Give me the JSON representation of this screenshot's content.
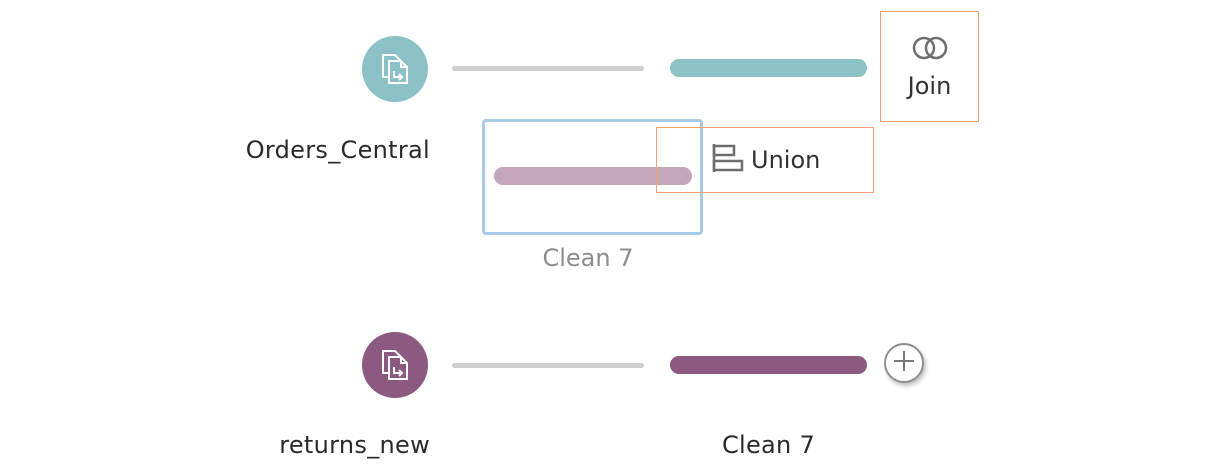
{
  "colors": {
    "teal": "#8dc1c8",
    "mauve": "#8c5a80",
    "mauve_light": "#c3a7b9",
    "connector_gray": "#cfcfcf",
    "drop_target_orange": "#f0a070",
    "ghost_border_blue": "#a6cbe8"
  },
  "flow": {
    "input_1": {
      "label": "Orders_Central",
      "icon": "file-input-icon"
    },
    "input_2": {
      "label": "returns_new",
      "icon": "file-input-icon"
    },
    "clean_2": {
      "label": "Clean 7"
    },
    "dragged_step": {
      "label": "Clean 7"
    },
    "drop_targets": {
      "join_label": "Join",
      "join_icon": "join-circles-icon",
      "union_label": "Union",
      "union_icon": "union-icon"
    },
    "add_step": {
      "icon": "plus-icon"
    }
  }
}
